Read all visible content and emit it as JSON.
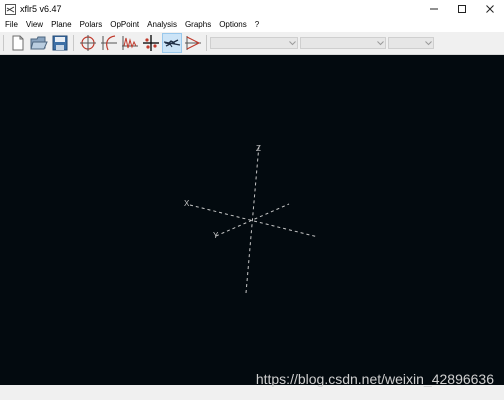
{
  "window": {
    "title": "xflr5 v6.47",
    "controls": [
      "–",
      "☐",
      "✕"
    ]
  },
  "menu": {
    "items": [
      "File",
      "View",
      "Plane",
      "Polars",
      "OpPoint",
      "Analysis",
      "Graphs",
      "Options",
      "?"
    ]
  },
  "toolbar": {
    "buttons": [
      "new-document-icon",
      "open-folder-icon",
      "save-disk-icon",
      "polar-view-icon",
      "polar-graph-icon",
      "cp-graph-icon",
      "stability-icon",
      "plane-3d-view-icon",
      "cp-view-icon"
    ],
    "active_button": "plane-3d-view-icon",
    "combos": [
      "",
      "",
      ""
    ]
  },
  "view": {
    "background_color": "#030a0f",
    "axis_color": "#c8c8c8",
    "axes": {
      "z_label": "Z",
      "x_label": "X",
      "y_label": "Y"
    }
  },
  "watermark": {
    "text": "https://blog.csdn.net/weixin_42896636"
  }
}
